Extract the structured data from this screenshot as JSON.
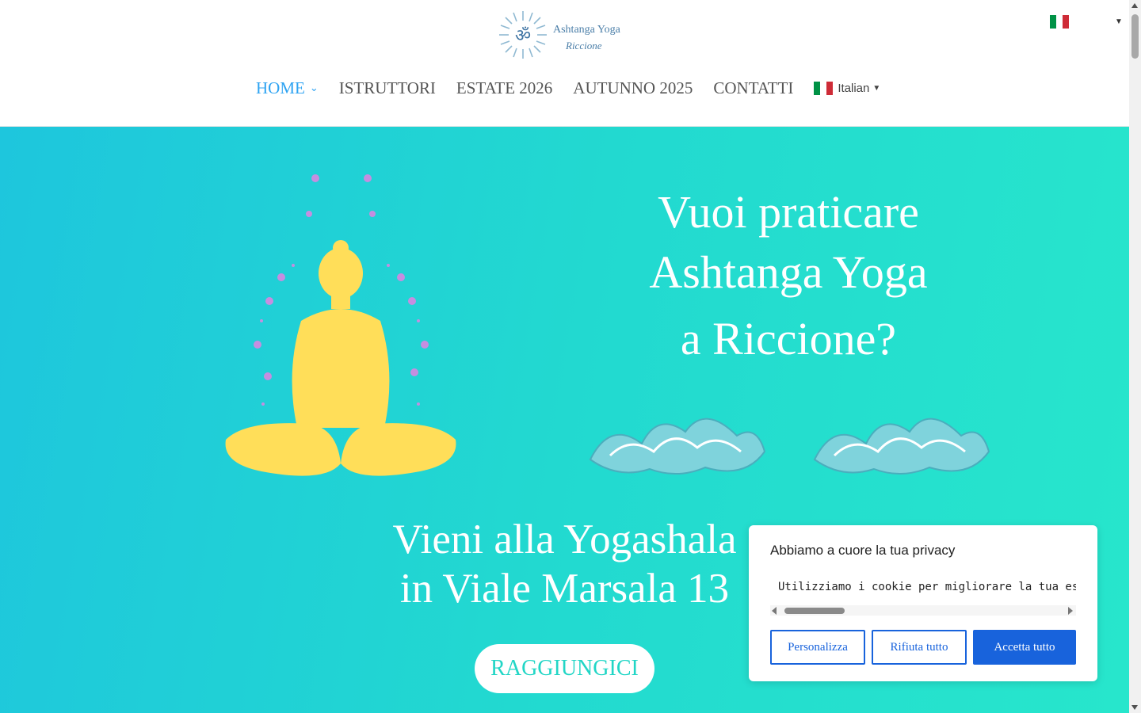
{
  "site": {
    "logo_line1": "Ashtanga Yoga",
    "logo_line2": "Riccione"
  },
  "nav": {
    "items": [
      {
        "label": "HOME",
        "active": true,
        "has_dropdown": true
      },
      {
        "label": "ISTRUTTORI",
        "active": false
      },
      {
        "label": "ESTATE 2026",
        "active": false
      },
      {
        "label": "AUTUNNO 2025",
        "active": false
      },
      {
        "label": "CONTATTI",
        "active": false
      }
    ],
    "language": "Italian"
  },
  "hero": {
    "headline_1": "Vuoi praticare",
    "headline_2": "Ashtanga Yoga",
    "headline_3": "a Riccione?",
    "subhead_1": "Vieni alla Yogashala",
    "subhead_2": "in Viale Marsala 13",
    "cta": "RAGGIUNGICI"
  },
  "cookie": {
    "title": "Abbiamo a cuore la tua privacy",
    "text": "Utilizziamo i cookie per migliorare la tua esperienza di navigazione",
    "customize": "Personalizza",
    "reject": "Rifiuta tutto",
    "accept": "Accetta tutto"
  },
  "colors": {
    "accent": "#2ea3f2",
    "hero_from": "#1ec6dd",
    "hero_to": "#27e6cc",
    "cookie_primary": "#1863dc",
    "figure": "#ffde59"
  }
}
